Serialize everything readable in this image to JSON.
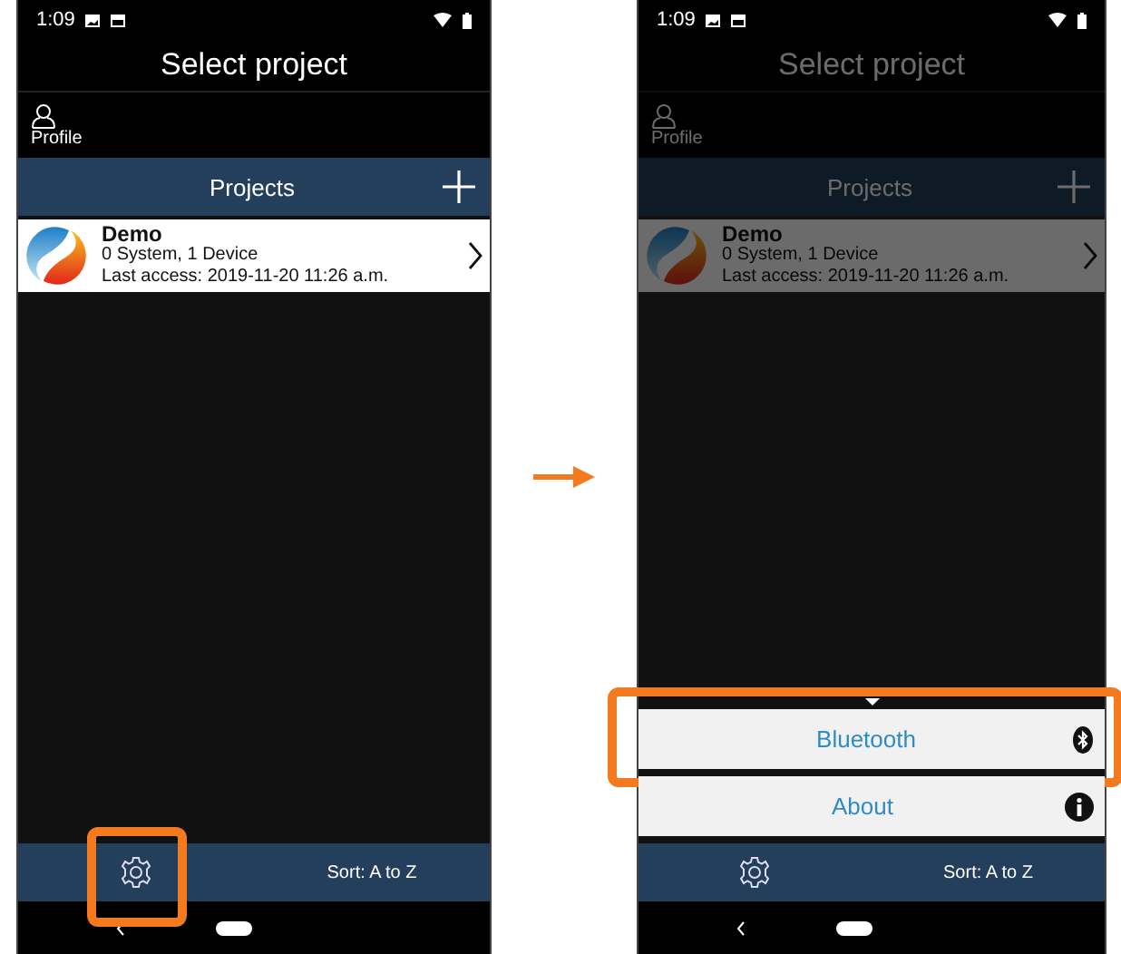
{
  "screens": [
    {
      "status_time": "1:09",
      "title": "Select project",
      "profile_label": "Profile",
      "section_title": "Projects",
      "dimmed": false,
      "projects": [
        {
          "name": "Demo",
          "summary": "0 System, 1 Device",
          "last_access": "Last access: 2019-11-20 11:26 a.m."
        }
      ],
      "settings_highlighted": true,
      "sort_label": "Sort: A to Z"
    },
    {
      "status_time": "1:09",
      "title": "Select project",
      "profile_label": "Profile",
      "section_title": "Projects",
      "dimmed": true,
      "projects": [
        {
          "name": "Demo",
          "summary": "0 System, 1 Device",
          "last_access": "Last access: 2019-11-20 11:26 a.m."
        }
      ],
      "settings_highlighted": false,
      "sort_label": "Sort: A to Z",
      "menu": [
        {
          "kind": "bluetooth",
          "label": "Bluetooth",
          "highlighted": true
        },
        {
          "kind": "info",
          "label": "About",
          "highlighted": false
        }
      ]
    }
  ]
}
